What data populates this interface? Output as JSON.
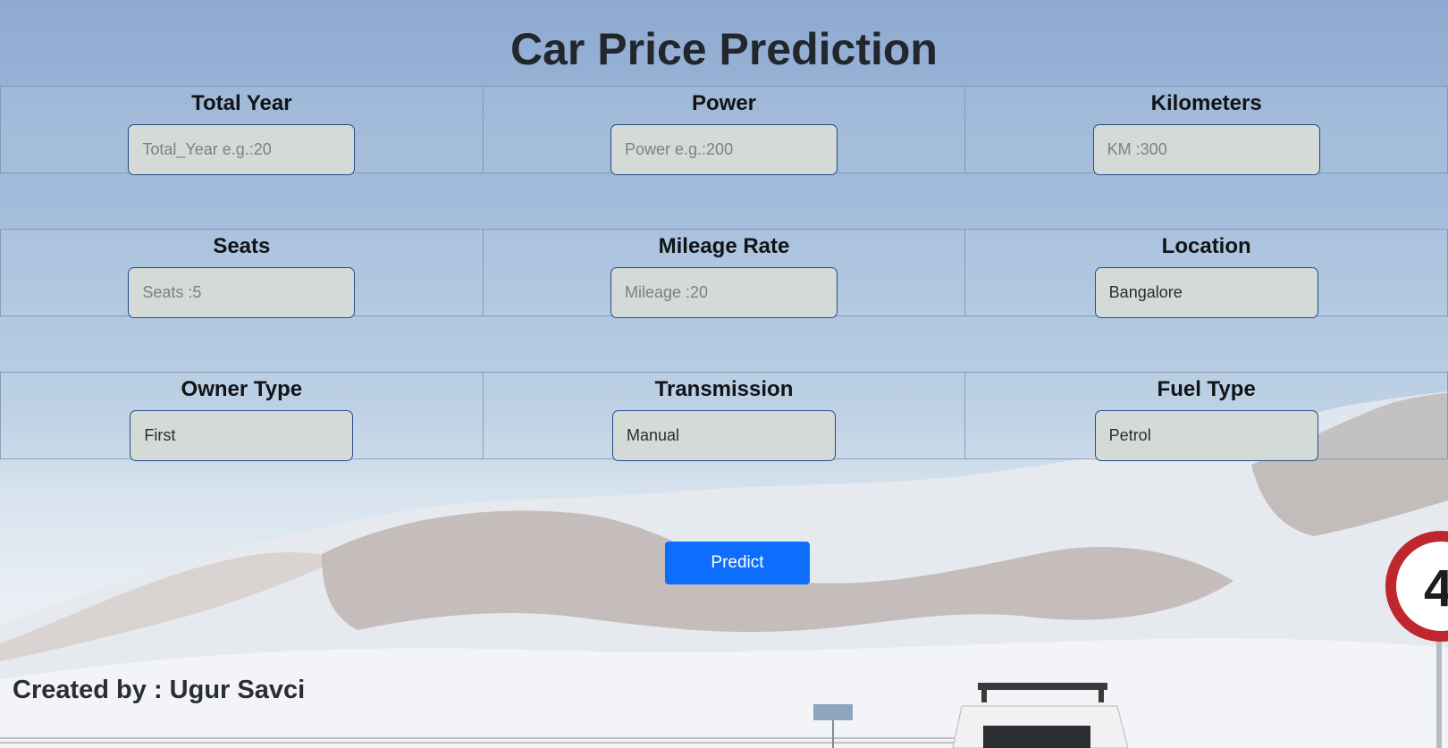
{
  "page": {
    "title": "Car Price Prediction"
  },
  "rows": [
    [
      {
        "label": "Total Year",
        "placeholder": "Total_Year e.g.:20",
        "value": ""
      },
      {
        "label": "Power",
        "placeholder": "Power e.g.:200",
        "value": ""
      },
      {
        "label": "Kilometers",
        "placeholder": "KM :300",
        "value": ""
      }
    ],
    [
      {
        "label": "Seats",
        "placeholder": "Seats :5",
        "value": ""
      },
      {
        "label": "Mileage Rate",
        "placeholder": "Mileage :20",
        "value": ""
      },
      {
        "label": "Location",
        "selected": "Bangalore"
      }
    ],
    [
      {
        "label": "Owner Type",
        "selected": "First"
      },
      {
        "label": "Transmission",
        "selected": "Manual"
      },
      {
        "label": "Fuel Type",
        "selected": "Petrol"
      }
    ]
  ],
  "predict_button": "Predict",
  "footer": {
    "credit": "Created by : Ugur Savci"
  },
  "colors": {
    "accent": "#0d6efd",
    "field_bg": "#d4dad6",
    "field_border": "#2a4c8a"
  },
  "sign_text": "4"
}
